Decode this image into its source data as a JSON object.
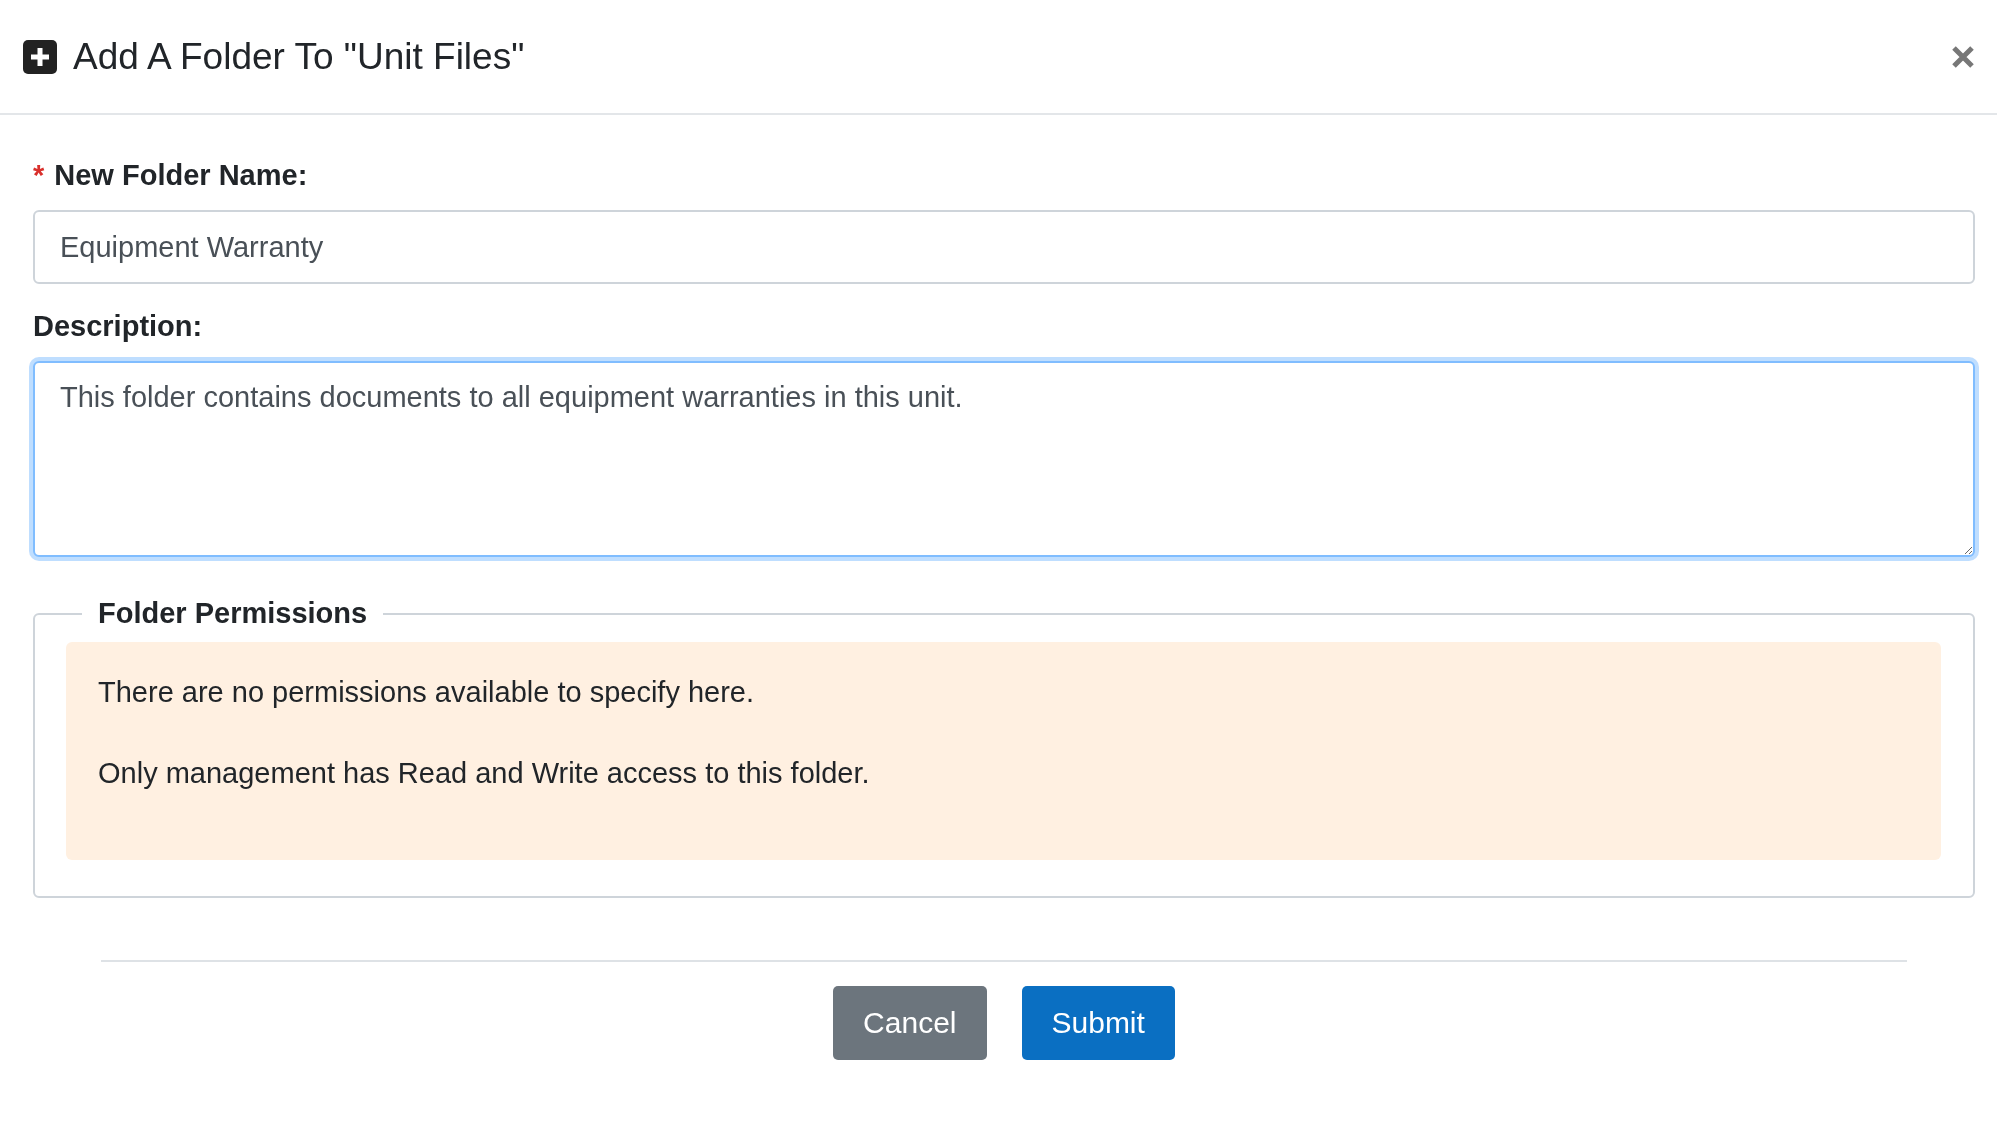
{
  "dialog": {
    "title": "Add A Folder To \"Unit Files\""
  },
  "fields": [
    {
      "kind": "input",
      "label": "New Folder Name:",
      "required_mark": "*",
      "value": "Equipment Warranty",
      "focused": false
    },
    {
      "kind": "textarea",
      "label": "Description:",
      "value": "This folder contains documents to all equipment warranties in this unit.",
      "focused": true
    }
  ],
  "permissions": {
    "legend": "Folder Permissions",
    "messages": [
      "There are no permissions available to specify here.",
      "Only management has Read and Write access to this folder."
    ]
  },
  "buttons": [
    {
      "label": "Cancel",
      "kind": "secondary"
    },
    {
      "label": "Submit",
      "kind": "primary"
    }
  ]
}
